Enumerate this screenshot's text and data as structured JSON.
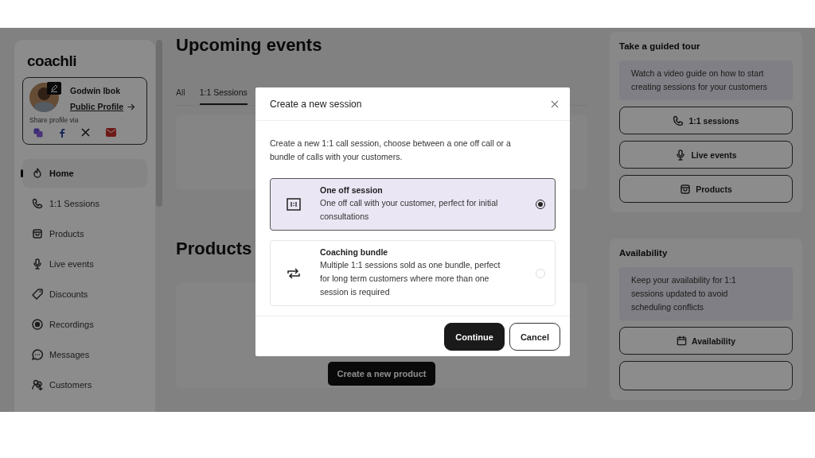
{
  "logo": "coachli",
  "profile": {
    "name": "Godwin Ibok",
    "link": "Public Profile",
    "share_label": "Share profile via"
  },
  "sidebar": {
    "items": [
      {
        "label": "Home",
        "selected": true
      },
      {
        "label": "1:1 Sessions",
        "selected": false
      },
      {
        "label": "Products",
        "selected": false
      },
      {
        "label": "Live events",
        "selected": false
      },
      {
        "label": "Discounts",
        "selected": false
      },
      {
        "label": "Recordings",
        "selected": false
      },
      {
        "label": "Messages",
        "selected": false
      },
      {
        "label": "Customers",
        "selected": false
      }
    ]
  },
  "main": {
    "title": "Upcoming events",
    "tabs": [
      {
        "label": "All",
        "selected": false
      },
      {
        "label": "1:1 Sessions",
        "selected": true
      }
    ],
    "products_title": "Products",
    "create_product_button": "Create a new product"
  },
  "guided_tour": {
    "title": "Take a guided tour",
    "note": "Watch a video guide on how to start creating sessions for your customers",
    "buttons": [
      "1:1 sessions",
      "Live events",
      "Products"
    ]
  },
  "availability": {
    "title": "Availability",
    "note": "Keep your availability for 1:1 sessions updated to avoid scheduling conflicts",
    "buttons": [
      "Availability"
    ]
  },
  "modal": {
    "title": "Create a new session",
    "description": "Create a new 1:1 call session, choose between a one off call or a bundle of calls with your customers.",
    "options": [
      {
        "title": "One off session",
        "description": "One off call with your customer, perfect for initial consultations",
        "selected": true
      },
      {
        "title": "Coaching bundle",
        "description": "Multiple 1:1 sessions sold as one bundle, perfect for long term customers where more than one session is required",
        "selected": false
      }
    ],
    "buttons": [
      {
        "label": "Continue",
        "kind": "primary"
      },
      {
        "label": "Cancel",
        "kind": "secondary"
      }
    ]
  }
}
